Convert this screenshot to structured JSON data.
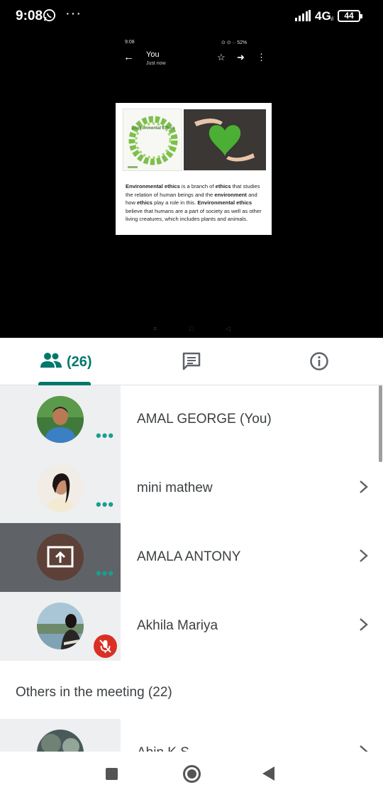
{
  "status_bar": {
    "time": "9:08",
    "more": "···",
    "network": "4G",
    "network_sub": "ıl",
    "battery": "44"
  },
  "shared_screen": {
    "inner_time": "9:08",
    "inner_icons": "⊙ ⊙ ·· 52%",
    "title": "You",
    "subtitle": "Just now",
    "doc_wreath_title": "Environmental Ethics",
    "doc_text_parts": [
      {
        "text": "Environmental ethics",
        "bold": true
      },
      {
        "text": " is a branch of ",
        "bold": false
      },
      {
        "text": "ethics",
        "bold": true
      },
      {
        "text": " that studies the relation of human beings and the ",
        "bold": false
      },
      {
        "text": "environment",
        "bold": true
      },
      {
        "text": " and how ",
        "bold": false
      },
      {
        "text": "ethics",
        "bold": true
      },
      {
        "text": " play a role in this. ",
        "bold": false
      },
      {
        "text": "Environmental ethics",
        "bold": true
      },
      {
        "text": " believe that humans are a part of society as well as other living creatures, which includes plants and animals.",
        "bold": false
      }
    ]
  },
  "tabs": {
    "people_count": "(26)"
  },
  "participants": [
    {
      "name": "AMAL GEORGE (You)",
      "avatar": "photo-man-blue-shirt",
      "presenting": false,
      "muted": false,
      "chevron": false
    },
    {
      "name": "mini mathew",
      "avatar": "photo-woman",
      "presenting": false,
      "muted": false,
      "chevron": true
    },
    {
      "name": "AMALA ANTONY",
      "avatar": "present-screen-icon",
      "presenting": true,
      "muted": false,
      "chevron": true
    },
    {
      "name": "Akhila Mariya",
      "avatar": "photo-woman-outdoor",
      "presenting": false,
      "muted": true,
      "chevron": true
    }
  ],
  "others_header": "Others in the meeting (22)",
  "others": [
    {
      "name": "Abin K S",
      "avatar": "photo-outdoor"
    }
  ],
  "colors": {
    "accent": "#00796b",
    "dots": "#1a9e8c",
    "presenting_bg": "#5f6368",
    "row_left_bg": "#eeeff1",
    "muted_badge": "#d93025"
  }
}
